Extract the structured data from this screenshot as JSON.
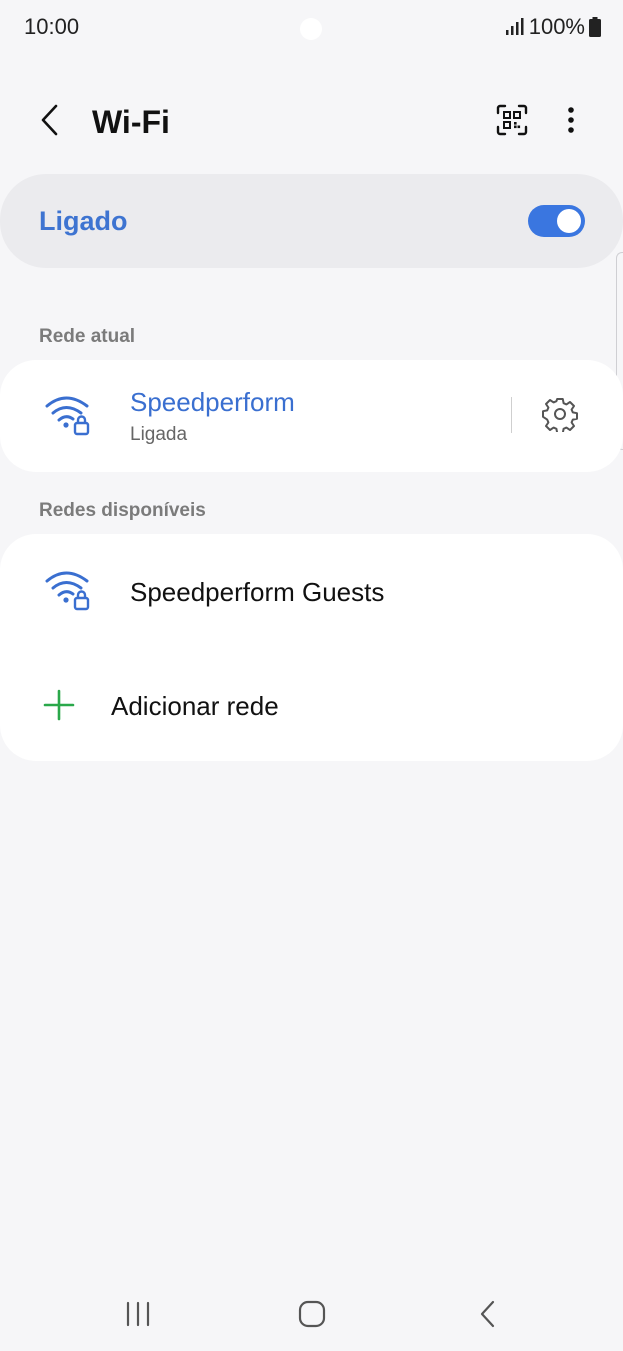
{
  "status_bar": {
    "time": "10:00",
    "battery": "100%",
    "signal_icon": "signal-bars-icon",
    "battery_icon": "battery-full-icon"
  },
  "app_bar": {
    "title": "Wi-Fi",
    "back_icon": "chevron-left-icon",
    "qr_icon": "qr-code-scan-icon",
    "more_icon": "more-vertical-icon"
  },
  "master_switch": {
    "label": "Ligado",
    "state": "on",
    "accent_color": "#3a76e0"
  },
  "current_network": {
    "section_title": "Rede atual",
    "name": "Speedperform",
    "status": "Ligada",
    "icon": "wifi-locked-icon",
    "settings_icon": "gear-icon"
  },
  "available_networks": {
    "section_title": "Redes disponíveis",
    "items": [
      {
        "name": "Speedperform Guests",
        "icon": "wifi-locked-icon"
      }
    ],
    "add_network": {
      "label": "Adicionar rede",
      "icon": "plus-icon",
      "icon_color": "#2aa84a"
    }
  },
  "nav_bar": {
    "recents_icon": "recents-icon",
    "home_icon": "home-icon",
    "back_icon": "back-icon"
  }
}
